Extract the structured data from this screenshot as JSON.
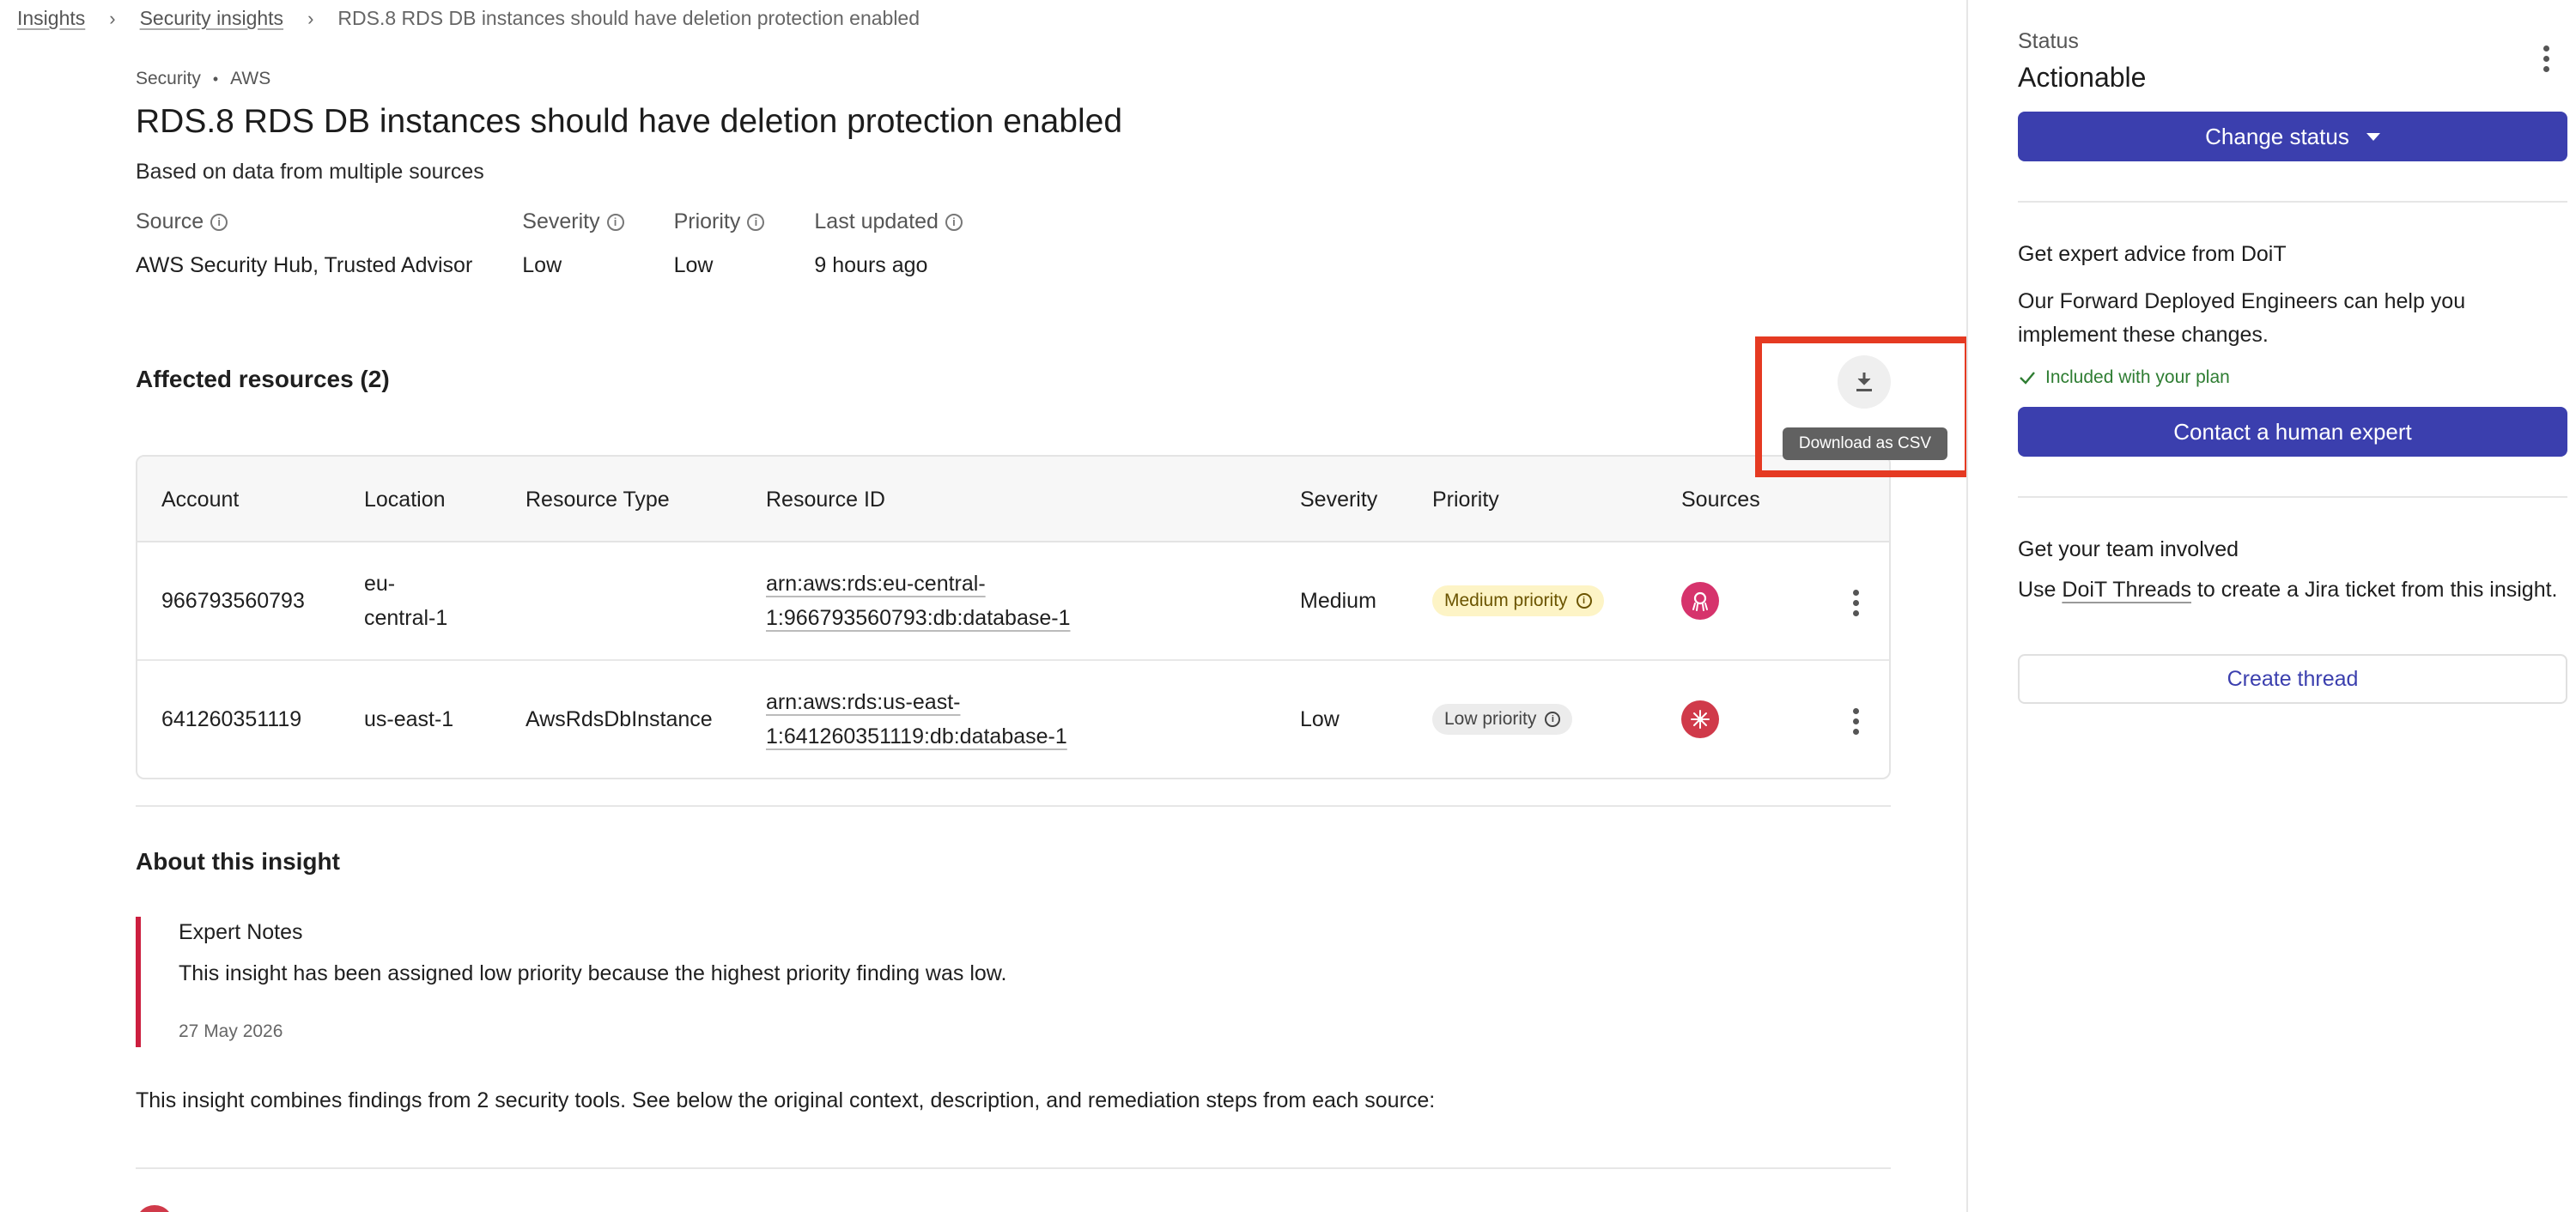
{
  "breadcrumb": {
    "items": [
      "Insights",
      "Security insights"
    ],
    "current": "RDS.8 RDS DB instances should have deletion protection enabled"
  },
  "header": {
    "category": "Security",
    "provider": "AWS",
    "title": "RDS.8 RDS DB instances should have deletion protection enabled",
    "subtitle": "Based on data from multiple sources"
  },
  "meta": {
    "source_label": "Source",
    "source_value": "AWS Security Hub, Trusted Advisor",
    "severity_label": "Severity",
    "severity_value": "Low",
    "priority_label": "Priority",
    "priority_value": "Low",
    "updated_label": "Last updated",
    "updated_value": "9 hours ago"
  },
  "affected": {
    "title": "Affected resources (2)",
    "download_tooltip": "Download as CSV",
    "columns": [
      "Account",
      "Location",
      "Resource Type",
      "Resource ID",
      "Severity",
      "Priority",
      "Sources"
    ],
    "rows": [
      {
        "account": "966793560793",
        "location_line1": "eu-",
        "location_line2": "central-1",
        "resource_type": "",
        "resource_id_line1": "arn:aws:rds:eu-central-",
        "resource_id_line2": "1:966793560793:db:database-1",
        "severity": "Medium",
        "priority": "Medium priority",
        "source_icon": "trusted-advisor-icon"
      },
      {
        "account": "641260351119",
        "location_line1": "us-east-1",
        "location_line2": "",
        "resource_type": "AwsRdsDbInstance",
        "resource_id_line1": "arn:aws:rds:us-east-",
        "resource_id_line2": "1:641260351119:db:database-1",
        "severity": "Low",
        "priority": "Low priority",
        "source_icon": "security-hub-icon"
      }
    ]
  },
  "about": {
    "title": "About this insight",
    "note_title": "Expert Notes",
    "note_body": "This insight has been assigned low priority because the highest priority finding was low.",
    "note_date": "27 May 2026",
    "combined_text": "This insight combines findings from 2 security tools. See below the original context, description, and remediation steps from each source:"
  },
  "side": {
    "status_label": "Status",
    "status_value": "Actionable",
    "change_status_label": "Change status",
    "expert_title": "Get expert advice from DoiT",
    "expert_body": "Our Forward Deployed Engineers can help you implement these changes.",
    "included_label": "Included with your plan",
    "contact_label": "Contact a human expert",
    "team_title": "Get your team involved",
    "team_body_pre": "Use ",
    "team_body_link": "DoiT Threads",
    "team_body_post": " to create a Jira ticket from this insight.",
    "create_thread_label": "Create thread"
  },
  "colors": {
    "primary": "#3b3fae",
    "highlight": "#e53a22",
    "note_accent": "#cc1f3f",
    "medium_chip": "#fdf4c6",
    "low_chip": "#ececec",
    "source_pink": "#d6336c",
    "source_red": "#d03a4a",
    "success": "#2e7d32"
  }
}
